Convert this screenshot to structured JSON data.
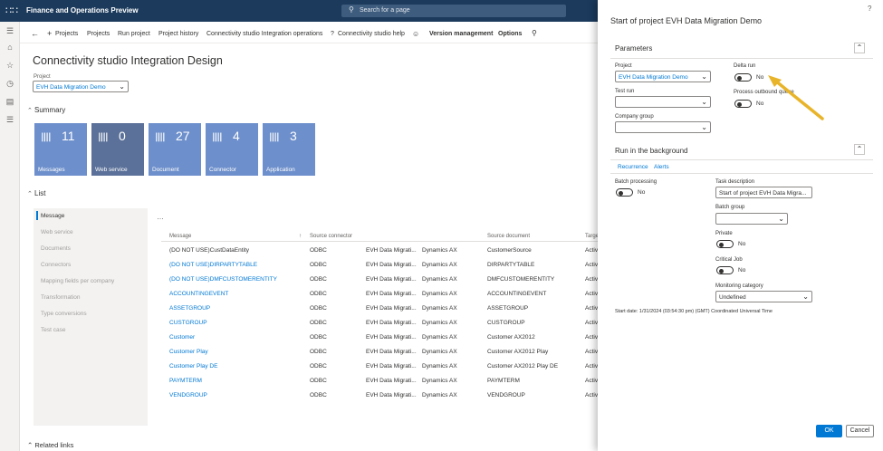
{
  "app": {
    "title": "Finance and Operations Preview",
    "search_placeholder": "Search for a page"
  },
  "actionbar": {
    "projects_new": "Projects",
    "projects": "Projects",
    "run_project": "Run project",
    "project_history": "Project history",
    "integration_ops": "Connectivity studio Integration operations",
    "help": "Connectivity studio help",
    "version_mgmt": "Version management",
    "options": "Options"
  },
  "page": {
    "title": "Connectivity studio Integration Design",
    "project_label": "Project",
    "project_value": "EVH Data Migration Demo"
  },
  "summary": {
    "heading": "Summary",
    "tiles": [
      {
        "label": "Messages",
        "count": "11"
      },
      {
        "label": "Web service",
        "count": "0"
      },
      {
        "label": "Document",
        "count": "27"
      },
      {
        "label": "Connector",
        "count": "4"
      },
      {
        "label": "Application",
        "count": "3"
      }
    ]
  },
  "list": {
    "heading": "List",
    "nav": [
      "Message",
      "Web service",
      "Documents",
      "Connectors",
      "Mapping fields per company",
      "Transformation",
      "Type conversions",
      "Test case"
    ],
    "columns": [
      "Message",
      "Source connector",
      "Source document",
      "Targe"
    ],
    "rows": [
      {
        "message": "(DO NOT USE)CustDataEntity",
        "link": false,
        "type": "ODBC",
        "src": "EVH Data Migrati...",
        "ax": "Dynamics AX",
        "doc": "CustomerSource",
        "tgt": "Activ"
      },
      {
        "message": "(DO NOT USE)DIRPARTYTABLE",
        "link": true,
        "type": "ODBC",
        "src": "EVH Data Migrati...",
        "ax": "Dynamics AX",
        "doc": "DIRPARTYTABLE",
        "tgt": "Activ"
      },
      {
        "message": "(DO NOT USE)DMFCUSTOMERENTITY",
        "link": true,
        "type": "ODBC",
        "src": "EVH Data Migrati...",
        "ax": "Dynamics AX",
        "doc": "DMFCUSTOMERENTITY",
        "tgt": "Activ"
      },
      {
        "message": "ACCOUNTINGEVENT",
        "link": true,
        "type": "ODBC",
        "src": "EVH Data Migrati...",
        "ax": "Dynamics AX",
        "doc": "ACCOUNTINGEVENT",
        "tgt": "Activ"
      },
      {
        "message": "ASSETGROUP",
        "link": true,
        "type": "ODBC",
        "src": "EVH Data Migrati...",
        "ax": "Dynamics AX",
        "doc": "ASSETGROUP",
        "tgt": "Activ"
      },
      {
        "message": "CUSTGROUP",
        "link": true,
        "type": "ODBC",
        "src": "EVH Data Migrati...",
        "ax": "Dynamics AX",
        "doc": "CUSTGROUP",
        "tgt": "Activ"
      },
      {
        "message": "Customer",
        "link": true,
        "type": "ODBC",
        "src": "EVH Data Migrati...",
        "ax": "Dynamics AX",
        "doc": "Customer AX2012",
        "tgt": "Activ"
      },
      {
        "message": "Customer Play",
        "link": true,
        "type": "ODBC",
        "src": "EVH Data Migrati...",
        "ax": "Dynamics AX",
        "doc": "Customer AX2012 Play",
        "tgt": "Activ"
      },
      {
        "message": "Customer Play DE",
        "link": true,
        "type": "ODBC",
        "src": "EVH Data Migrati...",
        "ax": "Dynamics AX",
        "doc": "Customer AX2012 Play DE",
        "tgt": "Activ"
      },
      {
        "message": "PAYMTERM",
        "link": true,
        "type": "ODBC",
        "src": "EVH Data Migrati...",
        "ax": "Dynamics AX",
        "doc": "PAYMTERM",
        "tgt": "Activ"
      },
      {
        "message": "VENDGROUP",
        "link": true,
        "type": "ODBC",
        "src": "EVH Data Migrati...",
        "ax": "Dynamics AX",
        "doc": "VENDGROUP",
        "tgt": "Activ"
      }
    ]
  },
  "related": {
    "heading": "Related links"
  },
  "dialog": {
    "title": "Start of project EVH Data Migration Demo",
    "parameters": "Parameters",
    "project_label": "Project",
    "project_value": "EVH Data Migration Demo",
    "test_run_label": "Test run",
    "company_group_label": "Company group",
    "delta_run_label": "Delta run",
    "delta_run_value": "No",
    "process_outbound_label": "Process outbound queue",
    "process_outbound_value": "No",
    "background": "Run in the background",
    "recurrence": "Recurrence",
    "alerts": "Alerts",
    "batch_processing_label": "Batch processing",
    "batch_processing_value": "No",
    "task_desc_label": "Task description",
    "task_desc_value": "Start of project EVH Data Migra...",
    "batch_group_label": "Batch group",
    "private_label": "Private",
    "private_value": "No",
    "critical_label": "Critical Job",
    "critical_value": "No",
    "monitoring_label": "Monitoring category",
    "monitoring_value": "Undefined",
    "start_date": "Start date: 1/31/2024 (03:54:30 pm) (GMT) Coordinated Universal Time",
    "ok": "OK",
    "cancel": "Cancel"
  }
}
